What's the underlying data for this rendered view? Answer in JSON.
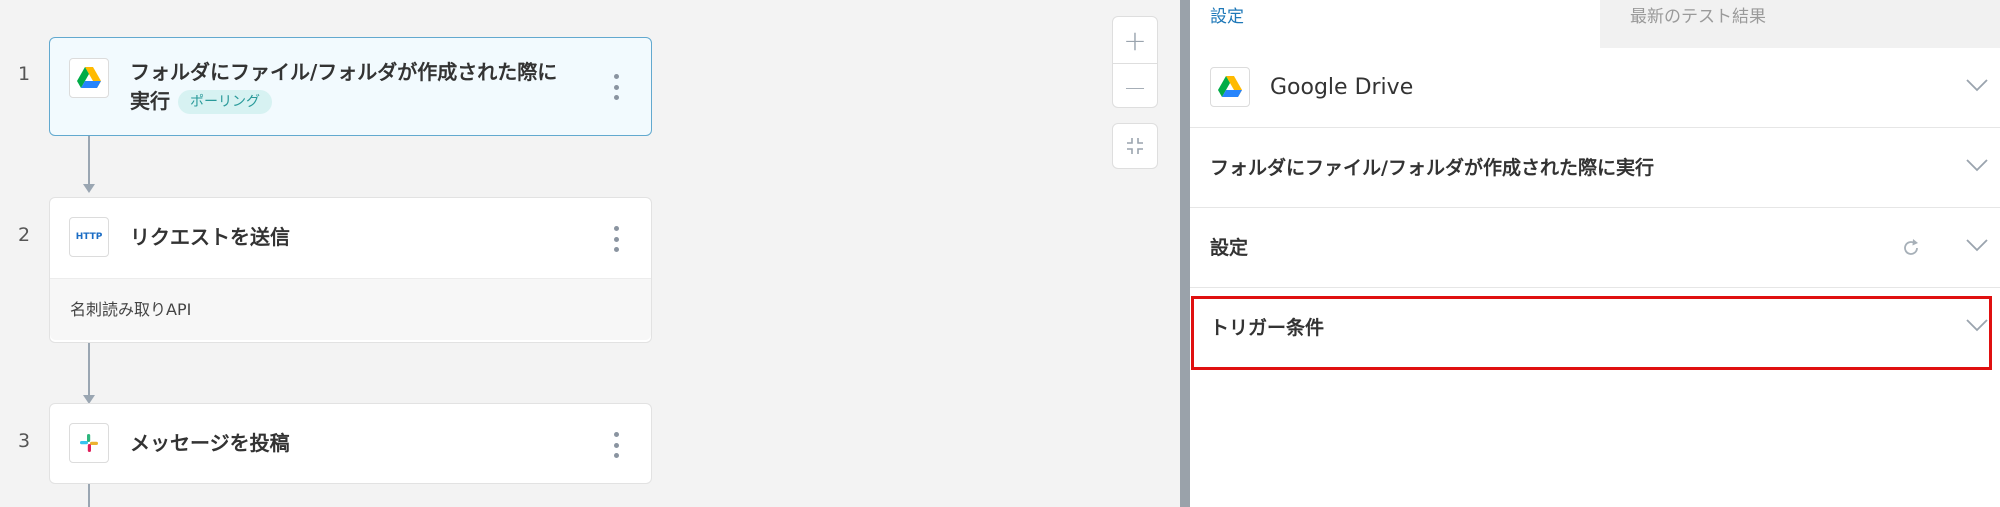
{
  "canvas": {
    "steps": [
      {
        "number": "1",
        "title_line1": "フォルダにファイル/フォルダが作成された際に",
        "title_line2": "実行",
        "badge": "ポーリング",
        "icon": "google-drive-icon"
      },
      {
        "number": "2",
        "title": "リクエストを送信",
        "icon_text": "HTTP",
        "body": "名刺読み取りAPI"
      },
      {
        "number": "3",
        "title": "メッセージを投稿",
        "icon": "slack-icon"
      }
    ],
    "zoom_in": "+",
    "zoom_out": "—"
  },
  "panel": {
    "tabs": [
      "設定",
      "最新のテスト結果"
    ],
    "app_name": "Google Drive",
    "trigger_name": "フォルダにファイル/フォルダが作成された際に実行",
    "settings_label": "設定",
    "trigger_conditions_label": "トリガー条件"
  },
  "colors": {
    "accent": "#1e78b8",
    "selected_border": "#62a9cf",
    "highlight": "#e01010",
    "badge_bg": "#d7f2f2",
    "badge_text": "#2a9a9a"
  }
}
